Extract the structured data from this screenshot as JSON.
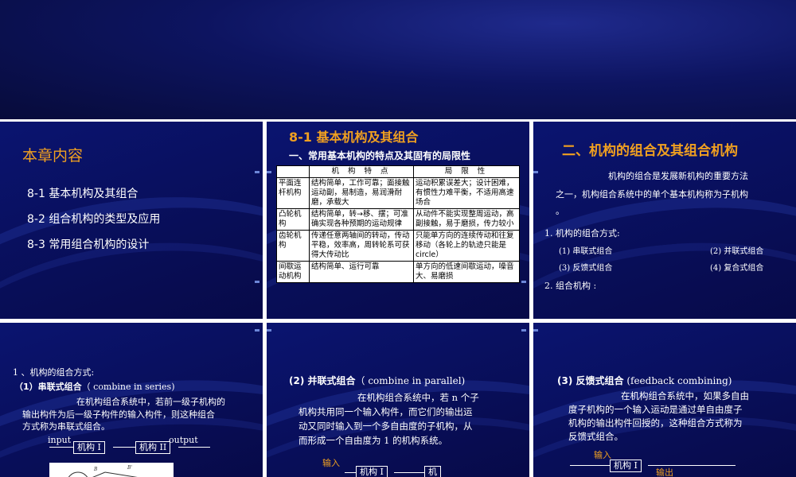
{
  "slide1": {
    "title": "本章内容",
    "items": [
      "8-1   基本机构及其组合",
      "8-2   组合机构的类型及应用",
      "8-3   常用组合机构的设计"
    ]
  },
  "slide2": {
    "title": "8-1    基本机构及其组合",
    "subtitle": "一、常用基本机构的特点及其固有的局限性",
    "table": {
      "headers": [
        "",
        "机 构 特 点",
        "局 限 性"
      ],
      "rows": [
        [
          "平面连杆机构",
          "结构简单，工作可靠；面接触运动副，易制造，易润滑耐磨，承载大",
          "运动积累误差大；设计困难，有惯性力难平衡，不适用高速场合"
        ],
        [
          "凸轮机构",
          "结构简单，转→移、摆；可准确实现各种预期的运动规律",
          "从动件不能实现整周运动，高副接触，易于磨损，传力较小"
        ],
        [
          "齿轮机构",
          "传递任意两轴间的转动，传动平稳，效率高，周转轮系可获得大传动比",
          "只能单方向的连续传动和往复移动（各轮上的轨迹只能是 circle）"
        ],
        [
          "间歇运动机构",
          "结构简单、运行可靠",
          "单方向的低速间歇运动，噪音大、易磨损"
        ]
      ]
    }
  },
  "slide3": {
    "title": "二、机构的组合及其组合机构",
    "intro_line1": "机构的组合是发展新机构的重要方法",
    "intro_line2": "之一，机构组合系统中的单个基本机构称为子机构",
    "intro_line3": "。",
    "point1": "1. 机构的组合方式:",
    "modes": [
      "(1) 串联式组合",
      "(2) 并联式组合",
      "(3) 反馈式组合",
      "(4) 复合式组合"
    ],
    "point2": "2. 组合机构 :"
  },
  "slide4": {
    "heading": "1 、机构的组合方式:",
    "sub_label": "（1）串联式组合",
    "sub_en": "（ combine in series)",
    "text_line1": "在机构组合系统中，若前一级子机构的",
    "text_line2": "输出构件为后一级子构件的输入构件，则这种组合",
    "text_line3": "方式称为串联式组合。",
    "input": "input",
    "box1": "机构 I",
    "box2": "机构 II",
    "output": "output",
    "fig_b": "B",
    "fig_b2": "B'"
  },
  "slide5": {
    "label": "(2)  并联式组合",
    "label_en": "（ combine in parallel)",
    "text_line1": "在机构组合系统中，若 n 个子",
    "text_line2": "机构共用同一个输入构件，而它们的输出运",
    "text_line3": "动又同时输入到一个多自由度的子机构，从",
    "text_line4": "而形成一个自由度为 1 的机构系统。",
    "input": "输入",
    "box1": "机构 I",
    "box2": "机"
  },
  "slide6": {
    "label": "(3)  反馈式组合",
    "label_en": "(feedback combining)",
    "text_line1": "在机构组合系统中，如果多自由",
    "text_line2": "度子机构的一个输入运动是通过单自由度子",
    "text_line3": "机构的输出构件回授的，这种组合方式称为",
    "text_line4": "反馈式组合。",
    "input": "输入",
    "box1": "机构 I",
    "output": "输出"
  }
}
